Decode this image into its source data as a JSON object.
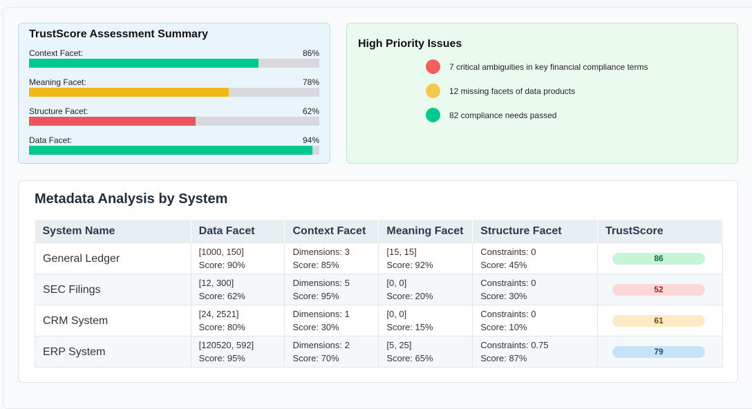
{
  "summary": {
    "title": "TrustScore Assessment Summary",
    "facets": [
      {
        "label": "Context Facet:",
        "percent_text": "86%",
        "value": 0.79,
        "color": "#00c98d"
      },
      {
        "label": "Meaning Facet:",
        "percent_text": "78%",
        "value": 0.687,
        "color": "#f0b915"
      },
      {
        "label": "Structure Facet:",
        "percent_text": "62%",
        "value": 0.574,
        "color": "#eb5757"
      },
      {
        "label": "Data Facet:",
        "percent_text": "94%",
        "value": 0.976,
        "color": "#00c98d"
      }
    ]
  },
  "priority": {
    "title": "High Priority Issues",
    "issues": [
      {
        "text": "7 critical ambiguities in key financial compliance terms",
        "color": "#f25f5f"
      },
      {
        "text": "12 missing facets of data products",
        "color": "#f2c94c"
      },
      {
        "text": "82 compliance needs passed",
        "color": "#00c98d"
      }
    ]
  },
  "table": {
    "title": "Metadata Analysis by System",
    "headers": [
      "System Name",
      "Data Facet",
      "Context Facet",
      "Meaning Facet",
      "Structure Facet",
      "TrustScore"
    ],
    "rows": [
      {
        "name": "General Ledger",
        "data": [
          "[1000, 150]",
          "Score: 90%"
        ],
        "context": [
          "Dimensions: 3",
          "Score: 85%"
        ],
        "meaning": [
          "[15, 15]",
          "Score: 92%"
        ],
        "structure": [
          "Constraints: 0",
          "Score: 45%"
        ],
        "score": "86",
        "badge_bg": "#c6f4d6",
        "badge_fg": "#17633a"
      },
      {
        "name": "SEC Filings",
        "data": [
          "[12, 300]",
          "Score: 62%"
        ],
        "context": [
          "Dimensions: 5",
          "Score: 95%"
        ],
        "meaning": [
          "[0, 0]",
          "Score: 20%"
        ],
        "structure": [
          "Constraints: 0",
          "Score: 30%"
        ],
        "score": "52",
        "badge_bg": "#fdd8d8",
        "badge_fg": "#9b1c1c"
      },
      {
        "name": "CRM System",
        "data": [
          "[24, 2521]",
          "Score: 80%"
        ],
        "context": [
          "Dimensions: 1",
          "Score: 30%"
        ],
        "meaning": [
          "[0, 0]",
          "Score: 15%"
        ],
        "structure": [
          "Constraints: 0",
          "Score: 10%"
        ],
        "score": "61",
        "badge_bg": "#fdebc6",
        "badge_fg": "#7a4a06"
      },
      {
        "name": "ERP System",
        "data": [
          "[120520, 592]",
          "Score: 95%"
        ],
        "context": [
          "Dimensions: 2",
          "Score: 70%"
        ],
        "meaning": [
          "[5, 25]",
          "Score: 65%"
        ],
        "structure": [
          "Constraints: 0.75",
          "Score: 87%"
        ],
        "score": "79",
        "badge_bg": "#c5e3f8",
        "badge_fg": "#1e4e79"
      }
    ]
  }
}
